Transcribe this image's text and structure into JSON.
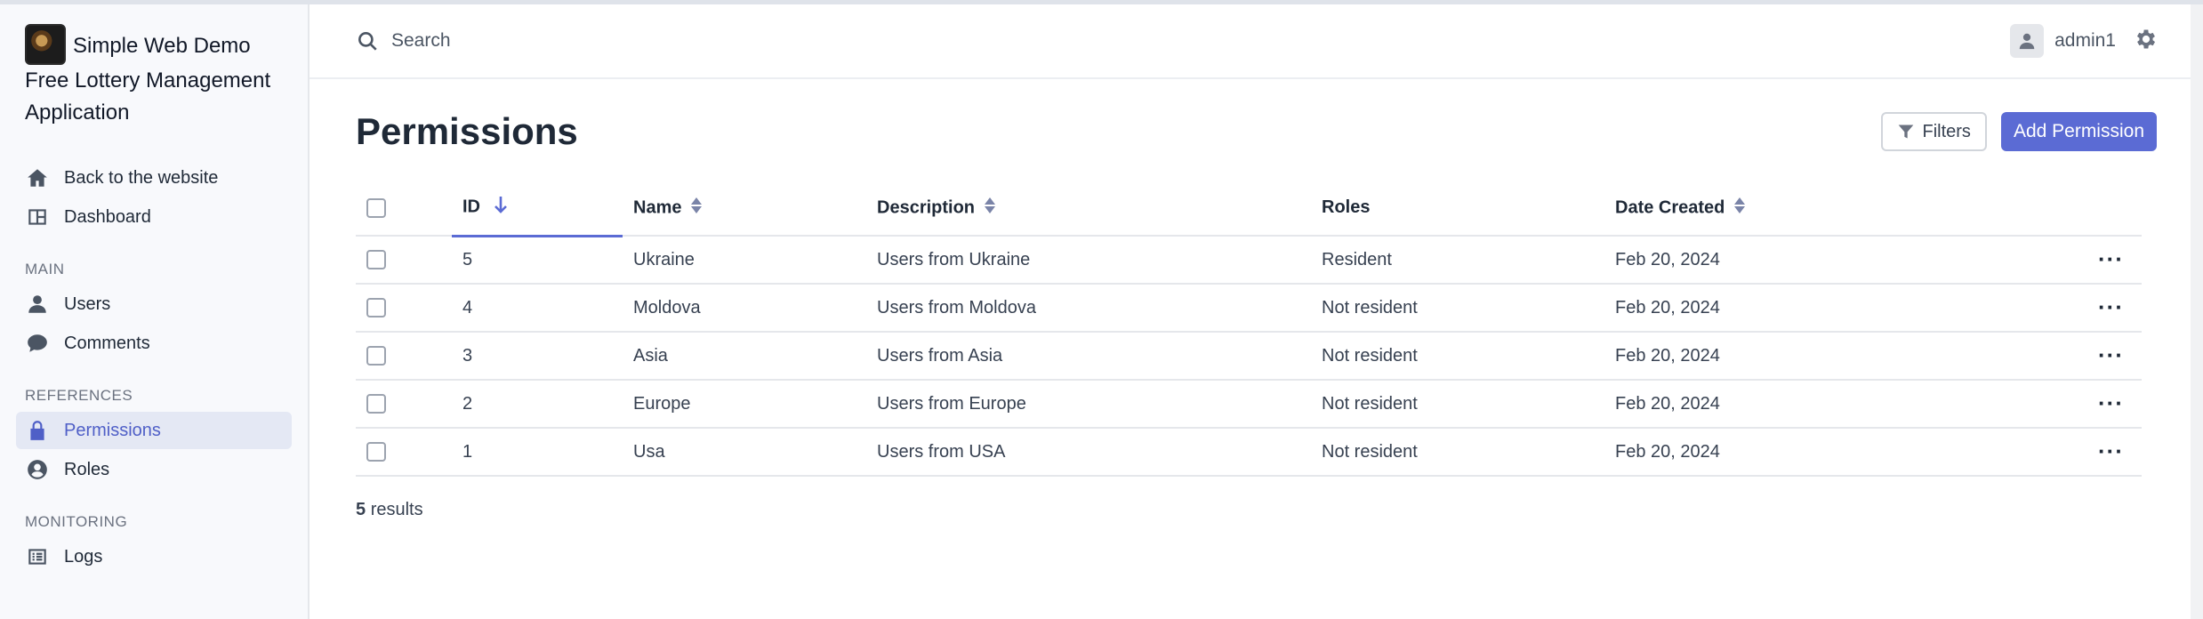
{
  "app": {
    "title_line1": "Simple Web Demo",
    "title_line2": "Free Lottery Management Application"
  },
  "sidebar": {
    "top_items": [
      {
        "label": "Back to the website",
        "icon": "home-icon"
      },
      {
        "label": "Dashboard",
        "icon": "dashboard-icon"
      }
    ],
    "sections": [
      {
        "title": "MAIN",
        "items": [
          {
            "label": "Users",
            "icon": "user-icon"
          },
          {
            "label": "Comments",
            "icon": "comment-icon"
          }
        ]
      },
      {
        "title": "REFERENCES",
        "items": [
          {
            "label": "Permissions",
            "icon": "lock-icon",
            "active": true
          },
          {
            "label": "Roles",
            "icon": "user-circle-icon"
          }
        ]
      },
      {
        "title": "MONITORING",
        "items": [
          {
            "label": "Logs",
            "icon": "list-icon"
          }
        ]
      }
    ]
  },
  "topbar": {
    "search_placeholder": "Search",
    "username": "admin1"
  },
  "page": {
    "title": "Permissions",
    "filters_label": "Filters",
    "add_label": "Add Permission"
  },
  "table": {
    "columns": [
      "ID",
      "Name",
      "Description",
      "Roles",
      "Date Created"
    ],
    "rows": [
      {
        "id": "5",
        "name": "Ukraine",
        "description": "Users from Ukraine",
        "roles": "Resident",
        "date": "Feb 20, 2024"
      },
      {
        "id": "4",
        "name": "Moldova",
        "description": "Users from Moldova",
        "roles": "Not resident",
        "date": "Feb 20, 2024"
      },
      {
        "id": "3",
        "name": "Asia",
        "description": "Users from Asia",
        "roles": "Not resident",
        "date": "Feb 20, 2024"
      },
      {
        "id": "2",
        "name": "Europe",
        "description": "Users from Europe",
        "roles": "Not resident",
        "date": "Feb 20, 2024"
      },
      {
        "id": "1",
        "name": "Usa",
        "description": "Users from USA",
        "roles": "Not resident",
        "date": "Feb 20, 2024"
      }
    ]
  },
  "footer": {
    "count": "5",
    "results_label": "results"
  },
  "colors": {
    "accent": "#5b6bd4",
    "sidebar_bg": "#f8f9fc",
    "active_bg": "#e4e8f4"
  }
}
